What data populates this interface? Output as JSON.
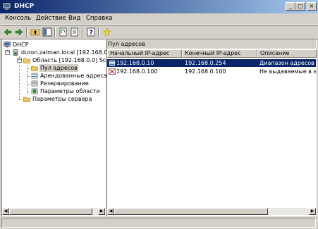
{
  "window": {
    "title": "DHCP"
  },
  "menu": [
    "Консоль",
    "Действие",
    "Вид",
    "Справка"
  ],
  "tree": {
    "root": "DHCP",
    "server": "duron.zalman.local [192.168.0.1",
    "scope": "Область [192.168.0.0] Scop",
    "items": [
      "Пул адресов",
      "Арендованные адреса",
      "Резервирование",
      "Параметры области"
    ],
    "server_options": "Параметры сервера"
  },
  "right_title": "Пул адресов",
  "columns": [
    "Начальный IP-адрес",
    "Конечный IP-адрес",
    "Описание"
  ],
  "rows": [
    {
      "start": "192.168.0.10",
      "end": "192.168.0.254",
      "desc": "Диапазон адресов для"
    },
    {
      "start": "192.168.0.100",
      "end": "192.168.0.100",
      "desc": "Не выдаваемые в арен"
    }
  ]
}
